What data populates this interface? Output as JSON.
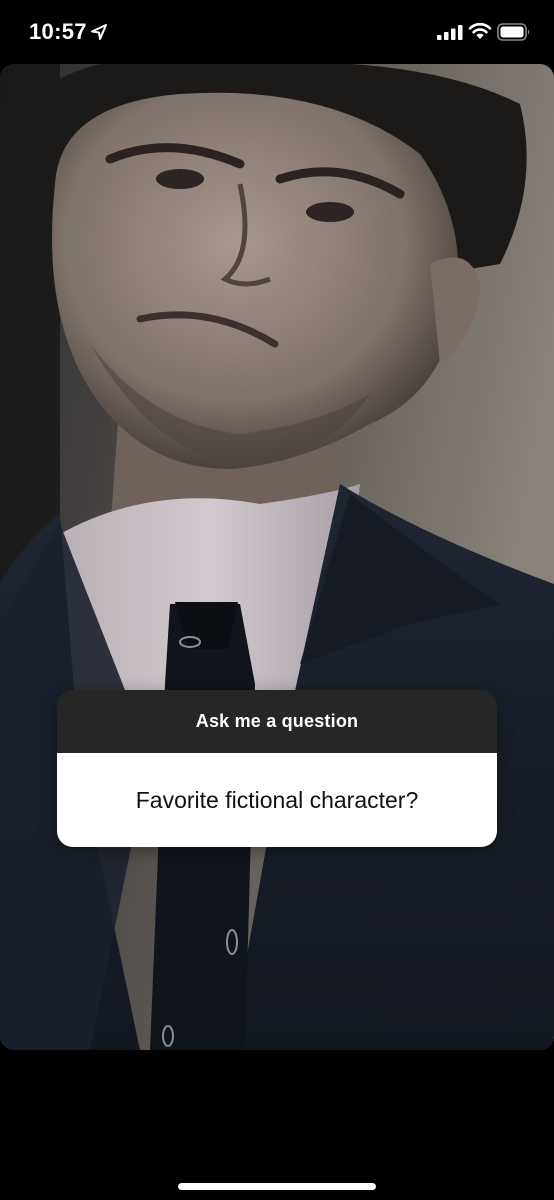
{
  "status_bar": {
    "time": "10:57",
    "icons": [
      "location-arrow-icon",
      "signal-icon",
      "wifi-icon",
      "battery-icon"
    ]
  },
  "story": {
    "image": "portrait-photo",
    "question_sticker": {
      "header": "Ask me a question",
      "response": "Favorite fictional character?",
      "header_color": "#262626",
      "body_color": "#ffffff"
    }
  }
}
